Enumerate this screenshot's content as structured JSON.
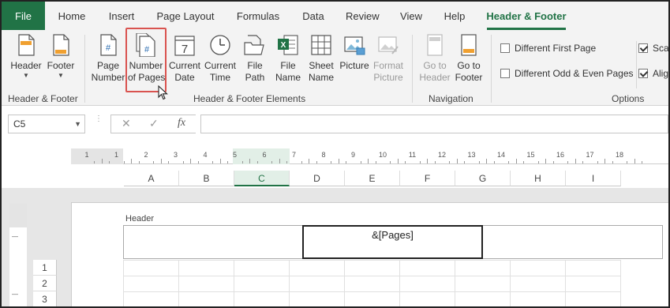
{
  "tabs": {
    "file": "File",
    "home": "Home",
    "insert": "Insert",
    "page_layout": "Page Layout",
    "formulas": "Formulas",
    "data": "Data",
    "review": "Review",
    "view": "View",
    "help": "Help",
    "header_footer": "Header & Footer"
  },
  "ribbon": {
    "header_label": "Header",
    "footer_label": "Footer",
    "page_number_1": "Page",
    "page_number_2": "Number",
    "number_of_pages_1": "Number",
    "number_of_pages_2": "of Pages",
    "current_date_1": "Current",
    "current_date_2": "Date",
    "current_time_1": "Current",
    "current_time_2": "Time",
    "file_path_1": "File",
    "file_path_2": "Path",
    "file_name_1": "File",
    "file_name_2": "Name",
    "sheet_name_1": "Sheet",
    "sheet_name_2": "Name",
    "picture": "Picture",
    "format_picture_1": "Format",
    "format_picture_2": "Picture",
    "go_to_header_1": "Go to",
    "go_to_header_2": "Header",
    "go_to_footer_1": "Go to",
    "go_to_footer_2": "Footer",
    "group_header_footer": "Header & Footer",
    "group_elements": "Header & Footer Elements",
    "group_navigation": "Navigation",
    "group_options": "Options",
    "opt_different_first": "Different First Page",
    "opt_different_odd_even": "Different Odd & Even Pages",
    "opt_scale": "Scal",
    "opt_align": "Alig",
    "date_digit": "7",
    "page_hash": "#"
  },
  "formula_bar": {
    "name_box": "C5",
    "cancel": "✕",
    "enter": "✓",
    "fx": "fx",
    "formula": ""
  },
  "ruler": {
    "numbers": [
      "1",
      "1",
      "2",
      "3",
      "4",
      "5",
      "6",
      "7",
      "8",
      "9",
      "10",
      "11",
      "12",
      "13",
      "14",
      "15",
      "16",
      "17",
      "18"
    ]
  },
  "columns": [
    "A",
    "B",
    "C",
    "D",
    "E",
    "F",
    "G",
    "H",
    "I"
  ],
  "selected_column": "C",
  "rows": [
    "1",
    "2",
    "3"
  ],
  "page": {
    "header_label": "Header",
    "header_center_text": "&[Pages]"
  },
  "colors": {
    "accent": "#217346",
    "highlight_border": "#d9534f"
  }
}
